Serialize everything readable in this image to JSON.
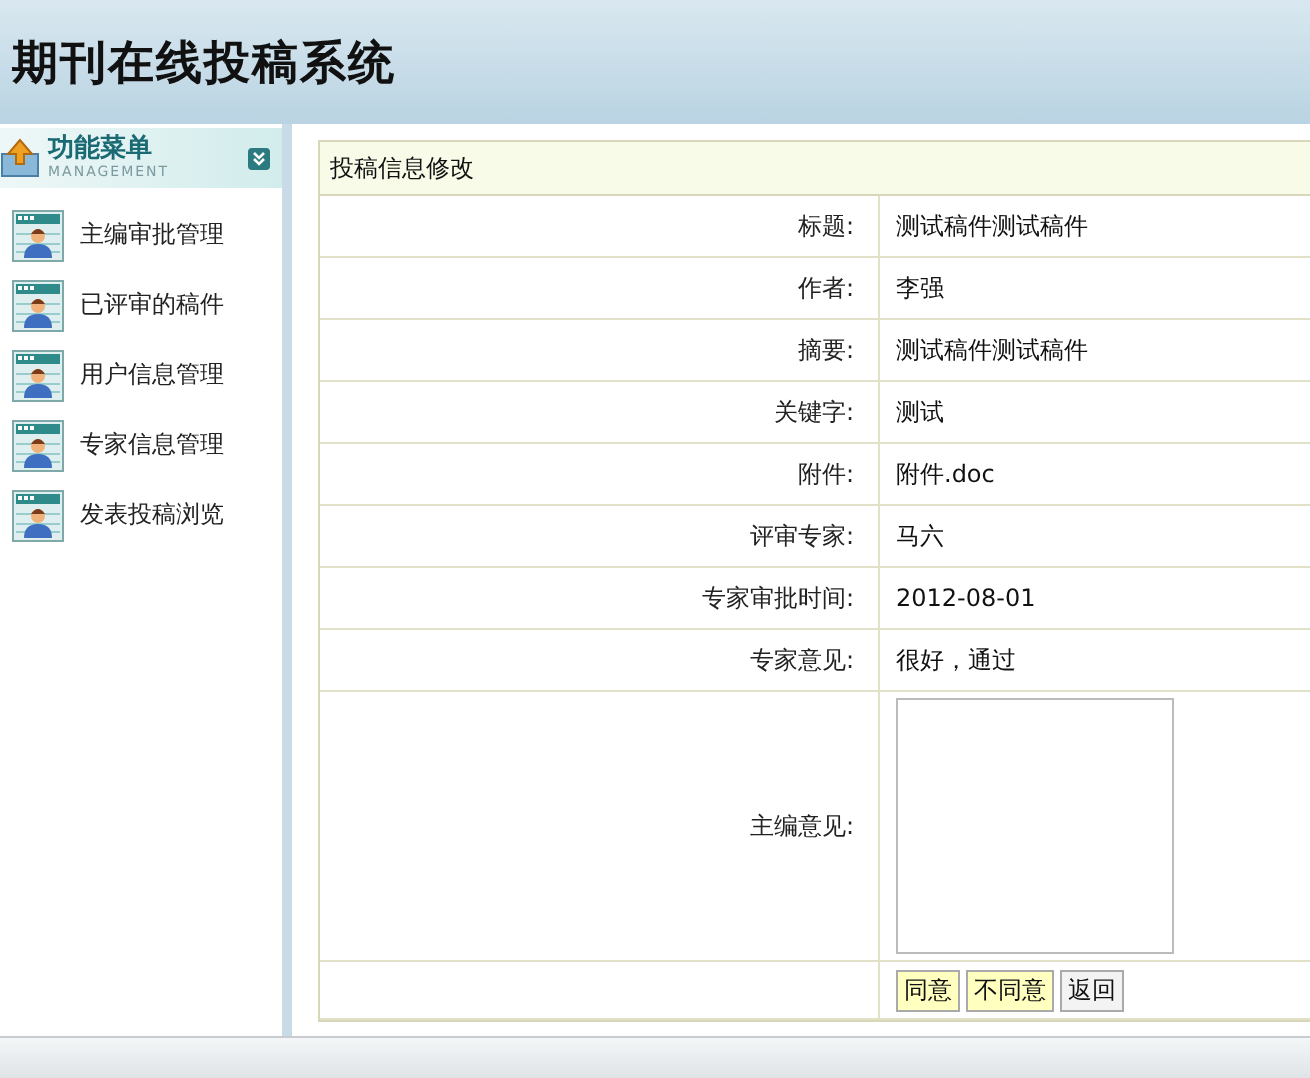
{
  "header": {
    "title": "期刊在线投稿系统"
  },
  "sidebar": {
    "title": "功能菜单",
    "subtitle": "MANAGEMENT",
    "items": [
      {
        "label": "主编审批管理"
      },
      {
        "label": "已评审的稿件"
      },
      {
        "label": "用户信息管理"
      },
      {
        "label": "专家信息管理"
      },
      {
        "label": "发表投稿浏览"
      }
    ]
  },
  "form": {
    "title": "投稿信息修改",
    "fields": [
      {
        "kind": "text",
        "label": "标题:",
        "value": "测试稿件测试稿件"
      },
      {
        "kind": "text",
        "label": "作者:",
        "value": "李强"
      },
      {
        "kind": "text",
        "label": "摘要:",
        "value": "测试稿件测试稿件"
      },
      {
        "kind": "text",
        "label": "关键字:",
        "value": "测试"
      },
      {
        "kind": "text",
        "label": "附件:",
        "value": "附件.doc"
      },
      {
        "kind": "text",
        "label": "评审专家:",
        "value": "马六"
      },
      {
        "kind": "text",
        "label": "专家审批时间:",
        "value": "2012-08-01"
      },
      {
        "kind": "text",
        "label": "专家意见:",
        "value": "很好，通过"
      },
      {
        "kind": "textarea",
        "label": "主编意见:"
      }
    ],
    "buttons": [
      {
        "label": "同意",
        "highlighted": true
      },
      {
        "label": "不同意",
        "highlighted": true
      },
      {
        "label": "返回",
        "highlighted": false
      }
    ]
  }
}
